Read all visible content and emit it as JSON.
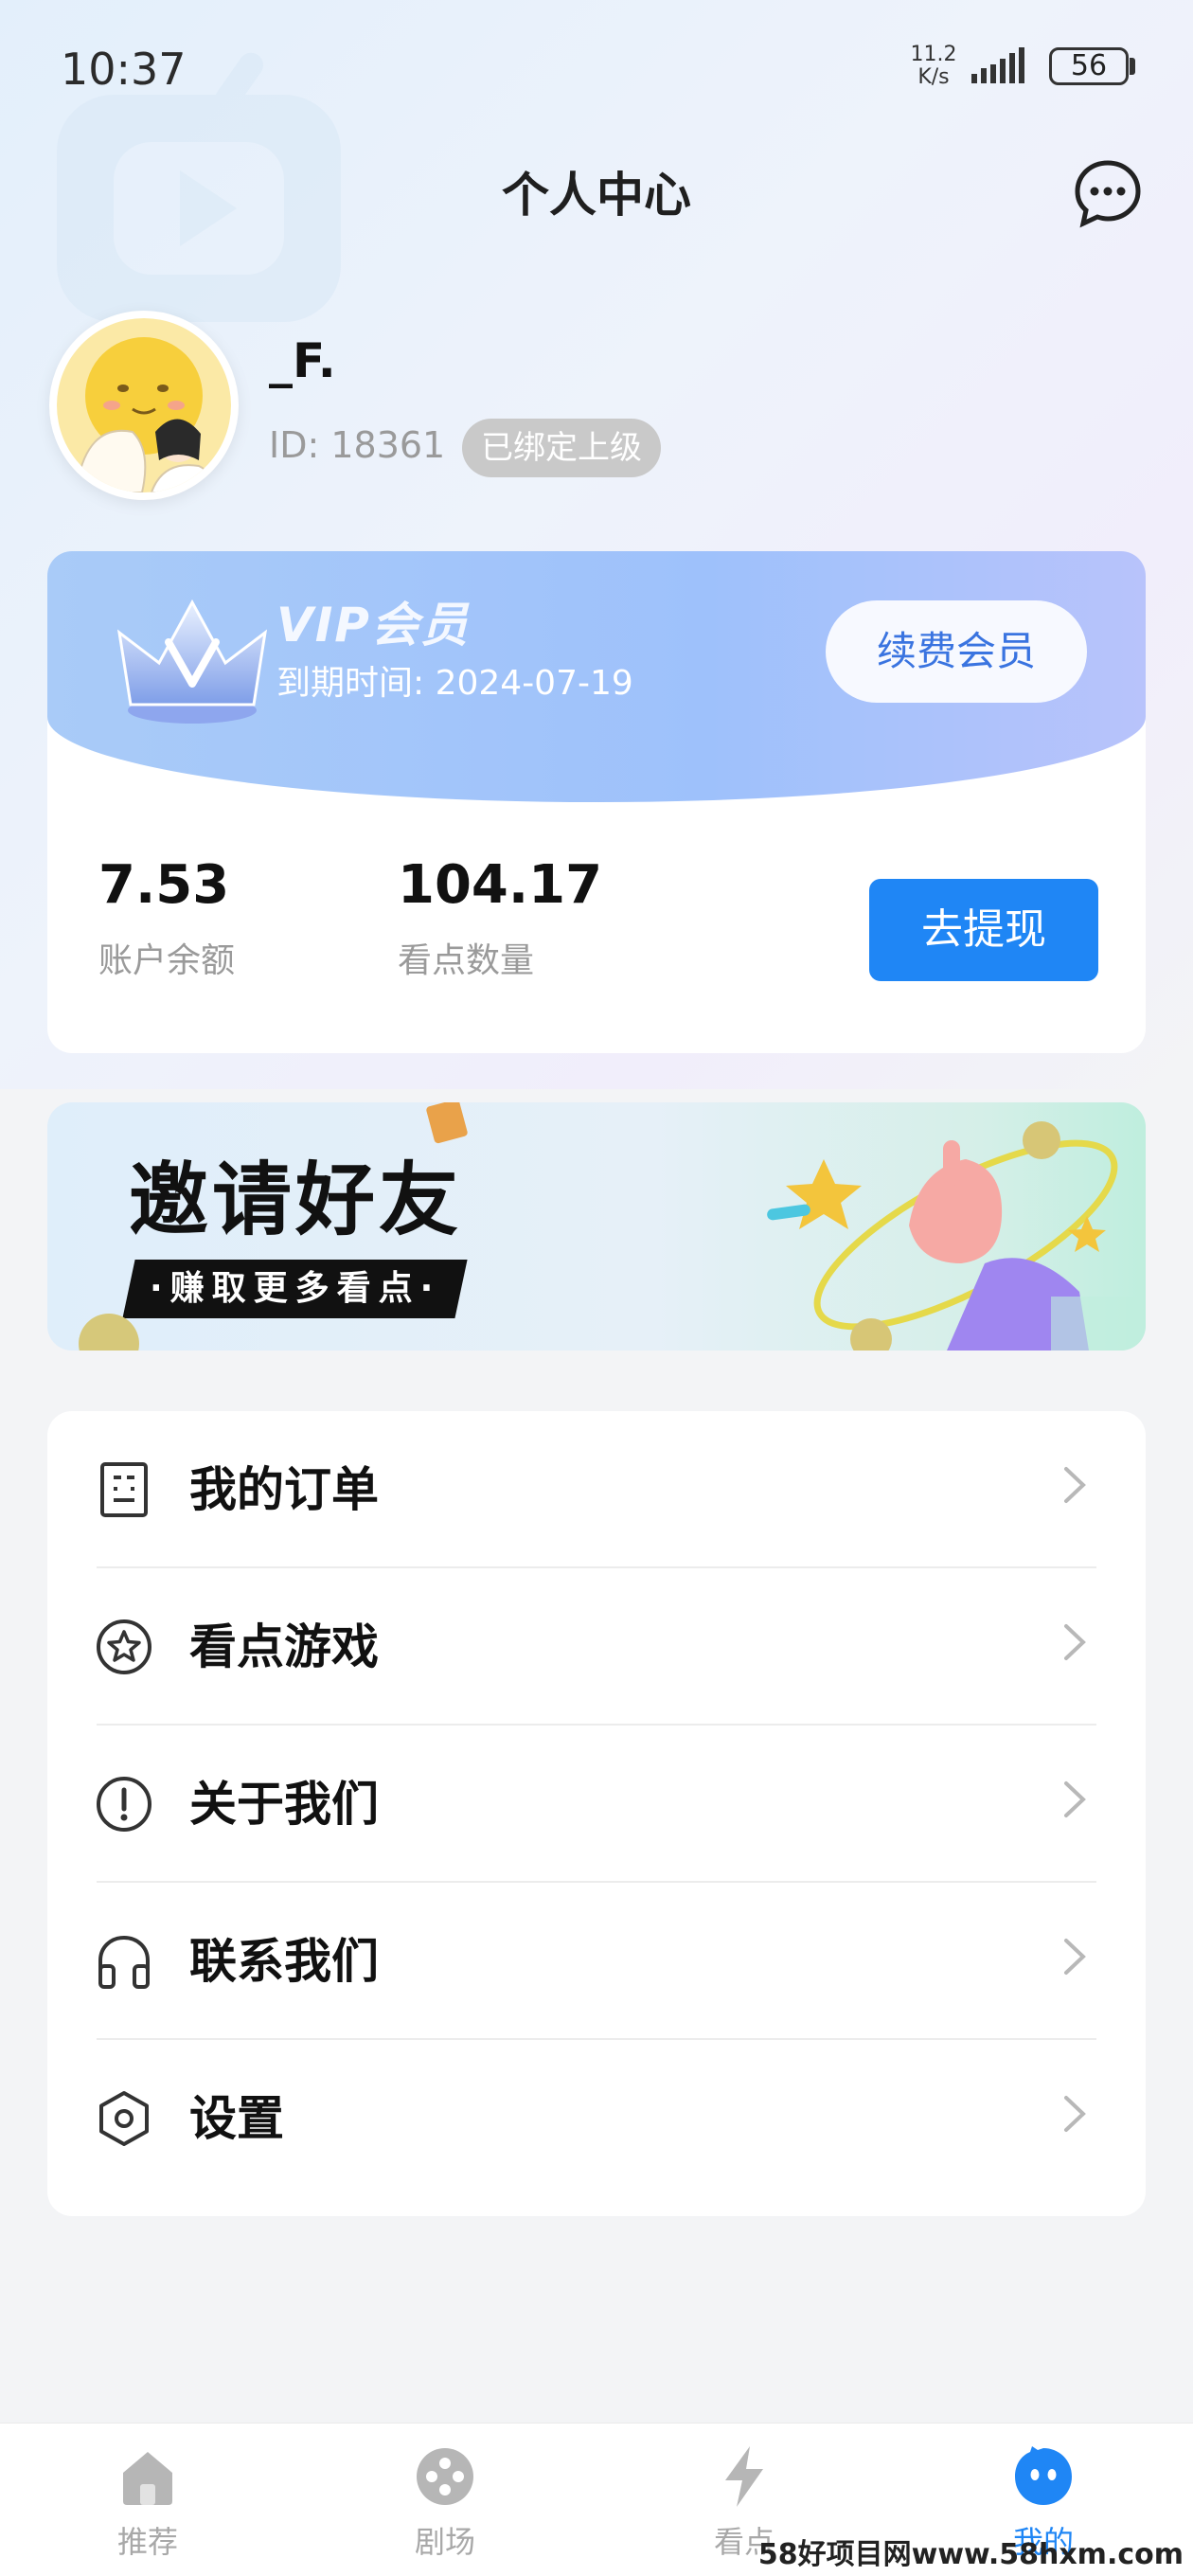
{
  "status_bar": {
    "time": "10:37",
    "net_speed_value": "11.2",
    "net_speed_unit": "K/s",
    "battery": "56"
  },
  "header": {
    "title": "个人中心",
    "message_icon": "chat-bubble-icon"
  },
  "profile": {
    "username": "_F.",
    "id_text": "ID:  18361",
    "bind_badge": "已绑定上级"
  },
  "vip": {
    "title": "VIP会员",
    "expire_text": "到期时间:  2024-07-19",
    "renew_button": "续费会员"
  },
  "stats": {
    "balance_value": "7.53",
    "balance_label": "账户余额",
    "points_value": "104.17",
    "points_label": "看点数量",
    "withdraw_button": "去提现"
  },
  "invite_banner": {
    "title": "邀请好友",
    "subtitle": "·赚取更多看点·"
  },
  "menu": {
    "items": [
      {
        "label": "我的订单",
        "icon": "order-list-icon"
      },
      {
        "label": "看点游戏",
        "icon": "star-circle-icon"
      },
      {
        "label": "关于我们",
        "icon": "exclamation-circle-icon"
      },
      {
        "label": "联系我们",
        "icon": "headphones-icon"
      },
      {
        "label": "设置",
        "icon": "hexagon-settings-icon"
      }
    ]
  },
  "tab_bar": {
    "tabs": [
      {
        "label": "推荐",
        "icon": "home-icon",
        "active": false
      },
      {
        "label": "剧场",
        "icon": "film-reel-icon",
        "active": false
      },
      {
        "label": "看点",
        "icon": "lightning-icon",
        "active": false
      },
      {
        "label": "我的",
        "icon": "mascot-face-icon",
        "active": true
      }
    ]
  },
  "colors": {
    "accent": "#1f86f5",
    "vip_gradient_start": "#a9cbf8",
    "vip_gradient_end": "#b8c3fb",
    "inactive_tab": "#a8a8a8"
  },
  "watermark": "58好项目网www.58hxm.com"
}
